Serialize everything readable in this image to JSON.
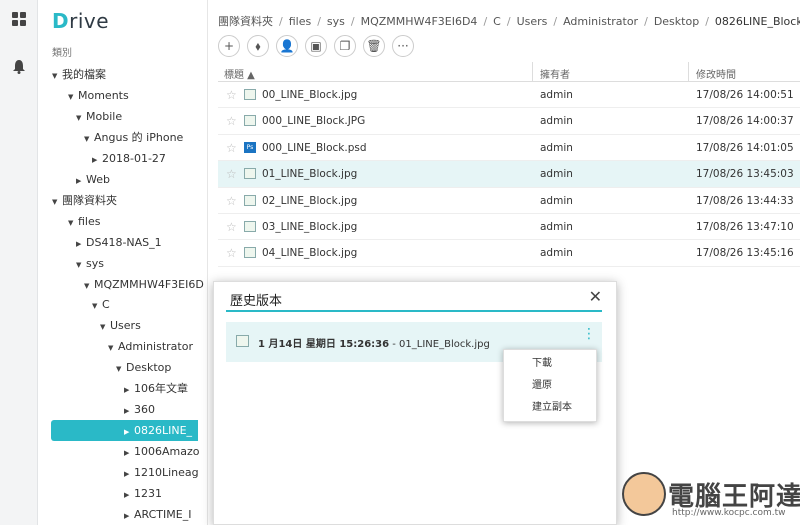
{
  "app": {
    "logo_d": "D",
    "logo_rest": "rive"
  },
  "sidebar": {
    "category_label": "類別",
    "items": [
      {
        "label": "我的檔案",
        "arrow": "▼"
      },
      {
        "label": "Moments",
        "arrow": "▼"
      },
      {
        "label": "Mobile",
        "arrow": "▼"
      },
      {
        "label": "Angus 的 iPhone",
        "arrow": "▼"
      },
      {
        "label": "2018-01-27",
        "arrow": "▶"
      },
      {
        "label": "Web",
        "arrow": "▶"
      },
      {
        "label": "團隊資料夾",
        "arrow": "▼"
      },
      {
        "label": "files",
        "arrow": "▼"
      },
      {
        "label": "DS418-NAS_1",
        "arrow": "▶"
      },
      {
        "label": "sys",
        "arrow": "▼"
      },
      {
        "label": "MQZMMHW4F3EI6D",
        "arrow": "▼"
      },
      {
        "label": "C",
        "arrow": "▼"
      },
      {
        "label": "Users",
        "arrow": "▼"
      },
      {
        "label": "Administrator",
        "arrow": "▼"
      },
      {
        "label": "Desktop",
        "arrow": "▼"
      },
      {
        "label": "106年文章",
        "arrow": "▶"
      },
      {
        "label": "360",
        "arrow": "▶"
      },
      {
        "label": "0826LINE_",
        "arrow": "▶"
      },
      {
        "label": "1006Amazo",
        "arrow": "▶"
      },
      {
        "label": "1210Lineag",
        "arrow": "▶"
      },
      {
        "label": "1231",
        "arrow": "▶"
      },
      {
        "label": "ARCTIME_I",
        "arrow": "▶"
      }
    ]
  },
  "breadcrumb": [
    "團隊資料夾",
    "files",
    "sys",
    "MQZMMHW4F3EI6D4",
    "C",
    "Users",
    "Administrator",
    "Desktop",
    "0826LINE_Block"
  ],
  "toolbar": {
    "icons": [
      "+",
      "⬧",
      "👤",
      "▣",
      "❐",
      "🗑",
      "···"
    ]
  },
  "table": {
    "headers": {
      "title": "標題 ▲",
      "owner": "擁有者",
      "modified": "修改時間"
    },
    "rows": [
      {
        "name": "00_LINE_Block.jpg",
        "owner": "admin",
        "time": "17/08/26 14:00:51"
      },
      {
        "name": "000_LINE_Block.JPG",
        "owner": "admin",
        "time": "17/08/26 14:00:37"
      },
      {
        "name": "000_LINE_Block.psd",
        "owner": "admin",
        "time": "17/08/26 14:01:05"
      },
      {
        "name": "01_LINE_Block.jpg",
        "owner": "admin",
        "time": "17/08/26 13:45:03"
      },
      {
        "name": "02_LINE_Block.jpg",
        "owner": "admin",
        "time": "17/08/26 13:44:33"
      },
      {
        "name": "03_LINE_Block.jpg",
        "owner": "admin",
        "time": "17/08/26 13:47:10"
      },
      {
        "name": "04_LINE_Block.jpg",
        "owner": "admin",
        "time": "17/08/26 13:45:16"
      }
    ]
  },
  "dialog": {
    "title": "歷史版本",
    "close": "✕",
    "version_date": "1 月14日 星期日 15:26:36",
    "version_file": " - 01_LINE_Block.jpg"
  },
  "menu": {
    "download": "下載",
    "restore": "還原",
    "copy": "建立副本"
  },
  "watermark": {
    "text": "電腦王阿達",
    "url": "http://www.kocpc.com.tw"
  }
}
